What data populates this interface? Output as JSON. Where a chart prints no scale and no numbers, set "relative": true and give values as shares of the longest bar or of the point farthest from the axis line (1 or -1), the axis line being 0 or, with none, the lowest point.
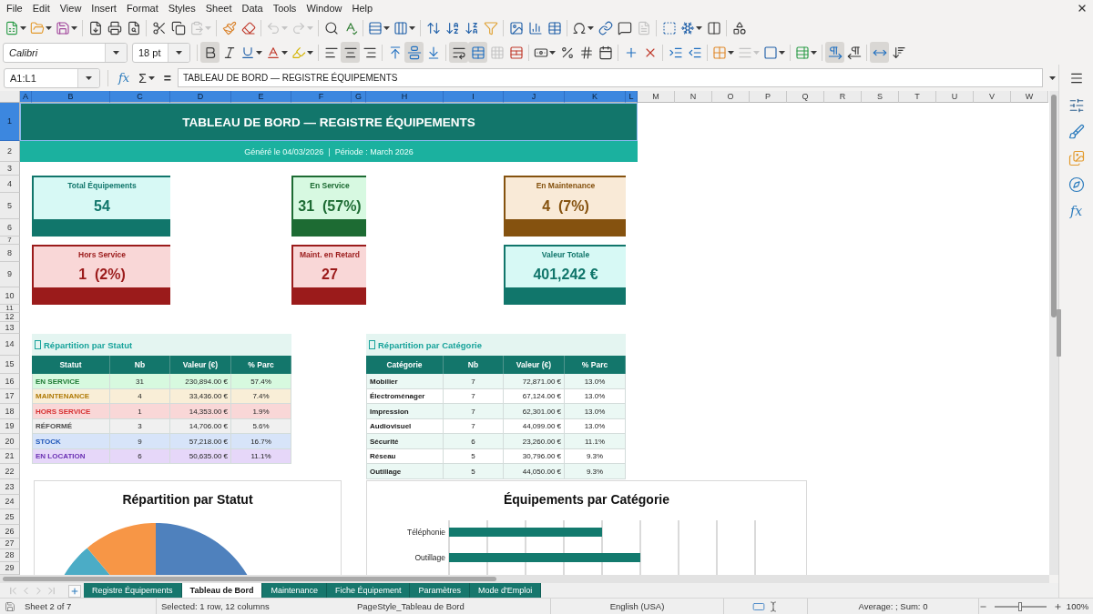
{
  "menu_bar": [
    "File",
    "Edit",
    "View",
    "Insert",
    "Format",
    "Styles",
    "Sheet",
    "Data",
    "Tools",
    "Window",
    "Help"
  ],
  "standard_toolbar": {
    "paste_disabled": true,
    "undo_disabled": true,
    "redo_disabled": true,
    "headers_footers_disabled": true
  },
  "formatting_toolbar": {
    "font_name": "Calibri",
    "font_size": "18 pt",
    "bold": true,
    "italic": false,
    "underline": false,
    "align_left": false,
    "align_center": true,
    "align_right": false,
    "align_top": false,
    "align_middle": true,
    "align_bottom": false,
    "wrap_text": true,
    "merge_and_center": true,
    "merge_disabled": true,
    "border_style_disabled": true,
    "left_to_right": true,
    "right_to_left": false,
    "horizontal_text": true,
    "vertical_text": false
  },
  "formula_bar": {
    "name_box": "A1:L1",
    "function_wizard": "fx",
    "sum": "Σ",
    "equals": "=",
    "content": "TABLEAU DE BORD — REGISTRE ÉQUIPEMENTS"
  },
  "sidebar": {
    "functions": "fx"
  },
  "columns": [
    {
      "label": "A",
      "selected": true
    },
    {
      "label": "B",
      "selected": true
    },
    {
      "label": "C",
      "selected": true
    },
    {
      "label": "D",
      "selected": true
    },
    {
      "label": "E",
      "selected": true
    },
    {
      "label": "F",
      "selected": true
    },
    {
      "label": "G",
      "selected": true
    },
    {
      "label": "H",
      "selected": true
    },
    {
      "label": "I",
      "selected": true
    },
    {
      "label": "J",
      "selected": true
    },
    {
      "label": "K",
      "selected": true
    },
    {
      "label": "L",
      "selected": true
    },
    {
      "label": "M",
      "selected": false
    },
    {
      "label": "N",
      "selected": false
    },
    {
      "label": "O",
      "selected": false
    },
    {
      "label": "P",
      "selected": false
    },
    {
      "label": "Q",
      "selected": false
    },
    {
      "label": "R",
      "selected": false
    },
    {
      "label": "S",
      "selected": false
    },
    {
      "label": "T",
      "selected": false
    },
    {
      "label": "U",
      "selected": false
    },
    {
      "label": "V",
      "selected": false
    },
    {
      "label": "W",
      "selected": false
    }
  ],
  "rows": [
    {
      "label": "1",
      "selected": true
    },
    {
      "label": "2",
      "selected": false
    },
    {
      "label": "3",
      "selected": false
    },
    {
      "label": "4",
      "selected": false
    },
    {
      "label": "5",
      "selected": false
    },
    {
      "label": "6",
      "selected": false
    },
    {
      "label": "7",
      "selected": false
    },
    {
      "label": "8",
      "selected": false
    },
    {
      "label": "9",
      "selected": false
    },
    {
      "label": "10",
      "selected": false
    },
    {
      "label": "11",
      "selected": false
    },
    {
      "label": "12",
      "selected": false
    },
    {
      "label": "13",
      "selected": false
    },
    {
      "label": "14",
      "selected": false
    },
    {
      "label": "15",
      "selected": false
    },
    {
      "label": "16",
      "selected": false
    },
    {
      "label": "17",
      "selected": false
    },
    {
      "label": "18",
      "selected": false
    },
    {
      "label": "19",
      "selected": false
    },
    {
      "label": "20",
      "selected": false
    },
    {
      "label": "21",
      "selected": false
    },
    {
      "label": "22",
      "selected": false
    },
    {
      "label": "23",
      "selected": false
    },
    {
      "label": "24",
      "selected": false
    },
    {
      "label": "25",
      "selected": false
    },
    {
      "label": "26",
      "selected": false
    },
    {
      "label": "27",
      "selected": false
    },
    {
      "label": "28",
      "selected": false
    },
    {
      "label": "29",
      "selected": false
    }
  ],
  "title": "TABLEAU DE BORD — REGISTRE ÉQUIPEMENTS",
  "subtitle": "Généré le 04/03/2026  |  Période : March 2026",
  "kpi_cards": [
    {
      "label": "Total Équipements",
      "value": "54",
      "color": "#11766b"
    },
    {
      "label": "En Service",
      "value": "31  (57%)",
      "color": "#1d6b33"
    },
    {
      "label": "En Maintenance",
      "value": "4  (7%)",
      "color": "#85520f"
    },
    {
      "label": "Hors Service",
      "value": "1  (2%)",
      "color": "#9b1b1b"
    },
    {
      "label": "Maint. en Retard",
      "value": "27",
      "color": "#9b1b1b"
    },
    {
      "label": "Valeur Totale",
      "value": "401,242 €",
      "color": "#11766b"
    }
  ],
  "status_table": {
    "title": "Répartition par Statut",
    "columns": [
      "Statut",
      "Nb",
      "Valeur (€)",
      "% Parc"
    ],
    "rows": [
      {
        "status": "EN SERVICE",
        "count": "31",
        "value": "230,894.00 €",
        "share": "57.4%",
        "color": "#1e7b34"
      },
      {
        "status": "MAINTENANCE",
        "count": "4",
        "value": "33,436.00 €",
        "share": "7.4%",
        "color": "#b07a06"
      },
      {
        "status": "HORS SERVICE",
        "count": "1",
        "value": "14,353.00 €",
        "share": "1.9%",
        "color": "#d63031"
      },
      {
        "status": "RÉFORMÉ",
        "count": "3",
        "value": "14,706.00 €",
        "share": "5.6%",
        "color": "#4d4d4d"
      },
      {
        "status": "STOCK",
        "count": "9",
        "value": "57,218.00 €",
        "share": "16.7%",
        "color": "#1f56b8"
      },
      {
        "status": "EN LOCATION",
        "count": "6",
        "value": "50,635.00 €",
        "share": "11.1%",
        "color": "#6a2fb3"
      }
    ]
  },
  "category_table": {
    "title": "Répartition par Catégorie",
    "columns": [
      "Catégorie",
      "Nb",
      "Valeur (€)",
      "% Parc"
    ],
    "rows": [
      {
        "category": "Mobilier",
        "count": "7",
        "value": "72,871.00 €",
        "share": "13.0%"
      },
      {
        "category": "Électroménager",
        "count": "7",
        "value": "67,124.00 €",
        "share": "13.0%"
      },
      {
        "category": "Impression",
        "count": "7",
        "value": "62,301.00 €",
        "share": "13.0%"
      },
      {
        "category": "Audiovisuel",
        "count": "7",
        "value": "44,099.00 €",
        "share": "13.0%"
      },
      {
        "category": "Sécurité",
        "count": "6",
        "value": "23,260.00 €",
        "share": "11.1%"
      },
      {
        "category": "Réseau",
        "count": "5",
        "value": "30,796.00 €",
        "share": "9.3%"
      },
      {
        "category": "Outillage",
        "count": "5",
        "value": "44,050.00 €",
        "share": "9.3%"
      }
    ]
  },
  "status_chart": {
    "title": "Répartition par Statut"
  },
  "category_chart": {
    "chart_data": {
      "type": "bar",
      "orientation": "horizontal",
      "title": "Équipements par Catégorie",
      "categories": [
        "Téléphonie",
        "Outillage"
      ],
      "values": [
        0.8,
        1
      ],
      "relative": true
    }
  },
  "sheet_tabs": [
    {
      "label": "Registre Équipements",
      "selected": false
    },
    {
      "label": "Tableau de Bord",
      "selected": true
    },
    {
      "label": "Maintenance",
      "selected": false
    },
    {
      "label": "Fiche Équipement",
      "selected": false
    },
    {
      "label": "Paramètres",
      "selected": false
    },
    {
      "label": "Mode d'Emploi",
      "selected": false
    }
  ],
  "status_bar": {
    "sheet": "Sheet 2 of 7",
    "selection": "Selected: 1 row, 12 columns",
    "page_style": "PageStyle_Tableau de Bord",
    "language": "English (USA)",
    "summary": "Average: ; Sum: 0",
    "zoom_slider": {
      "level": 0.5
    },
    "zoom": "100%"
  }
}
